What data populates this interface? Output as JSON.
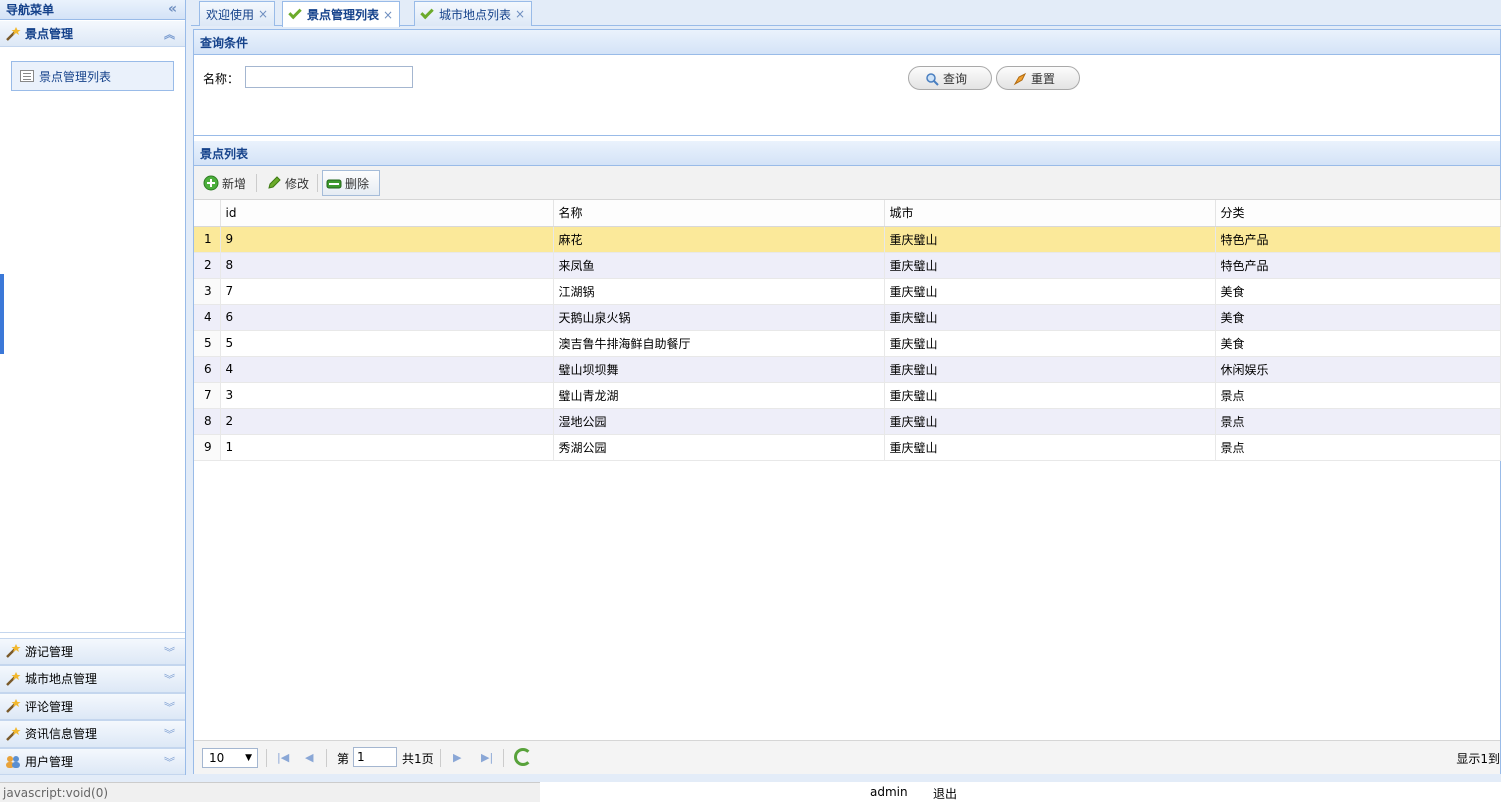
{
  "sidebar": {
    "title": "导航菜单",
    "collapse_symbol": "«",
    "open_section": {
      "label": "景点管理",
      "items": [
        {
          "label": "景点管理列表"
        }
      ]
    },
    "sections": [
      {
        "label": "游记管理"
      },
      {
        "label": "城市地点管理"
      },
      {
        "label": "评论管理"
      },
      {
        "label": "资讯信息管理"
      },
      {
        "label": "用户管理"
      }
    ]
  },
  "tabs": [
    {
      "label": "欢迎使用",
      "close": "×"
    },
    {
      "label": "景点管理列表",
      "close": "×"
    },
    {
      "label": "城市地点列表",
      "close": "×"
    }
  ],
  "query": {
    "title": "查询条件",
    "name_label": "名称：",
    "name_value": "",
    "search_label": "查询",
    "reset_label": "重置"
  },
  "list": {
    "title": "景点列表",
    "toolbar": {
      "add": "新增",
      "edit": "修改",
      "delete": "删除"
    },
    "columns": [
      "id",
      "名称",
      "城市",
      "分类"
    ],
    "rows": [
      {
        "n": "1",
        "id": "9",
        "name": "麻花",
        "city": "重庆璧山",
        "category": "特色产品"
      },
      {
        "n": "2",
        "id": "8",
        "name": "来凤鱼",
        "city": "重庆璧山",
        "category": "特色产品"
      },
      {
        "n": "3",
        "id": "7",
        "name": "江湖锅",
        "city": "重庆璧山",
        "category": "美食"
      },
      {
        "n": "4",
        "id": "6",
        "name": "天鹅山泉火锅",
        "city": "重庆璧山",
        "category": "美食"
      },
      {
        "n": "5",
        "id": "5",
        "name": "澳吉鲁牛排海鲜自助餐厅",
        "city": "重庆璧山",
        "category": "美食"
      },
      {
        "n": "6",
        "id": "4",
        "name": "璧山坝坝舞",
        "city": "重庆璧山",
        "category": "休闲娱乐"
      },
      {
        "n": "7",
        "id": "3",
        "name": "璧山青龙湖",
        "city": "重庆璧山",
        "category": "景点"
      },
      {
        "n": "8",
        "id": "2",
        "name": "湿地公园",
        "city": "重庆璧山",
        "category": "景点"
      },
      {
        "n": "9",
        "id": "1",
        "name": "秀湖公园",
        "city": "重庆璧山",
        "category": "景点"
      }
    ]
  },
  "pager": {
    "page_size": "10",
    "page_prefix": "第",
    "page_value": "1",
    "total_pages": "共1页",
    "info": "显示1到"
  },
  "statusbar": {
    "link": "javascript:void(0)",
    "user": "admin",
    "logout": "退出"
  }
}
